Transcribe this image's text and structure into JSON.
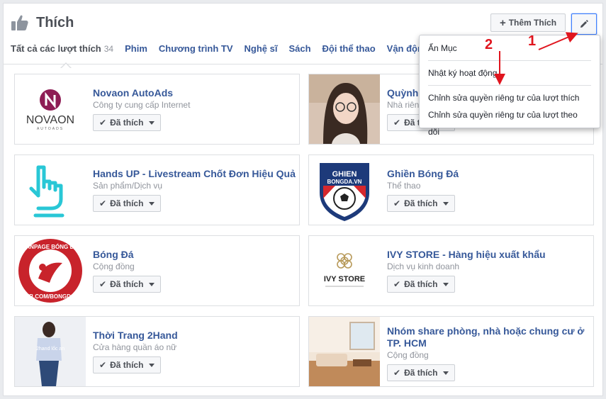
{
  "header": {
    "title": "Thích",
    "add_button": "Thêm Thích"
  },
  "tabs": [
    {
      "label": "Tất cả các lượt thích",
      "count": "34"
    },
    {
      "label": "Phim"
    },
    {
      "label": "Chương trình TV"
    },
    {
      "label": "Nghệ sĩ"
    },
    {
      "label": "Sách"
    },
    {
      "label": "Đội thể thao"
    },
    {
      "label": "Vận động viên"
    }
  ],
  "menu": {
    "items": [
      "Ẩn Mục",
      "Nhật ký hoạt động",
      "Chỉnh sửa quyền riêng tư của lượt thích",
      "Chỉnh sửa quyền riêng tư của lượt theo dõi"
    ]
  },
  "liked_label": "Đã thích",
  "pages": [
    {
      "name": "Novaon AutoAds",
      "category": "Công ty cung cấp Internet",
      "logo_text": "NOVAON",
      "logo_sub": "AUTOADS"
    },
    {
      "name": "Quỳnh",
      "category": "Nhà riêng"
    },
    {
      "name": "Hands UP - Livestream Chốt Đơn Hiệu Quả",
      "category": "Sản phẩm/Dịch vụ"
    },
    {
      "name": "Ghiền Bóng Đá",
      "category": "Thể thao",
      "logo_text": "GHIEN",
      "logo_sub": "BONGDA.VN"
    },
    {
      "name": "Bóng Đá",
      "category": "Cộng đồng",
      "logo_text": "FANPAGE BÓNG ĐÁ",
      "logo_sub": "FB.COM/BONGDA"
    },
    {
      "name": "IVY STORE - Hàng hiệu xuất khẩu",
      "category": "Dịch vụ kinh doanh",
      "logo_text": "IVY STORE"
    },
    {
      "name": "Thời Trang 2Hand",
      "category": "Cửa hàng quần áo nữ",
      "logo_text": "2hand lốc an"
    },
    {
      "name": "Nhóm share phòng, nhà hoặc chung cư ở TP. HCM",
      "category": "Cộng đồng"
    }
  ],
  "annotations": {
    "one": "1",
    "two": "2"
  },
  "colors": {
    "link": "#365899",
    "accent": "#4080ff",
    "annotation": "#e0151e"
  }
}
